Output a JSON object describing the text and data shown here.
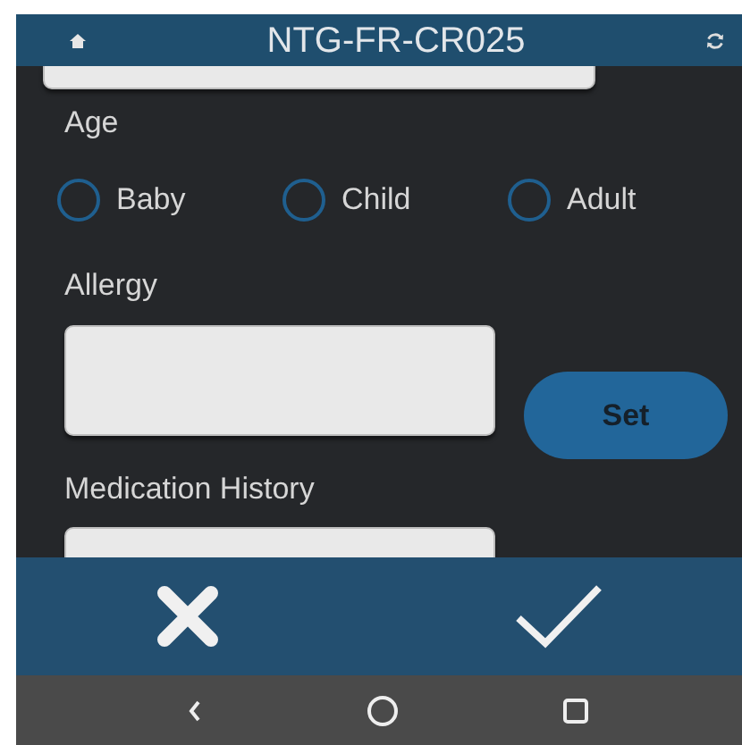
{
  "header": {
    "title": "NTG-FR-CR025"
  },
  "age": {
    "label": "Age",
    "options": [
      {
        "label": "Baby",
        "selected": false
      },
      {
        "label": "Child",
        "selected": false
      },
      {
        "label": "Adult",
        "selected": false
      }
    ]
  },
  "allergy": {
    "label": "Allergy"
  },
  "set_button": {
    "label": "Set"
  },
  "medication_history": {
    "label": "Medication History"
  }
}
